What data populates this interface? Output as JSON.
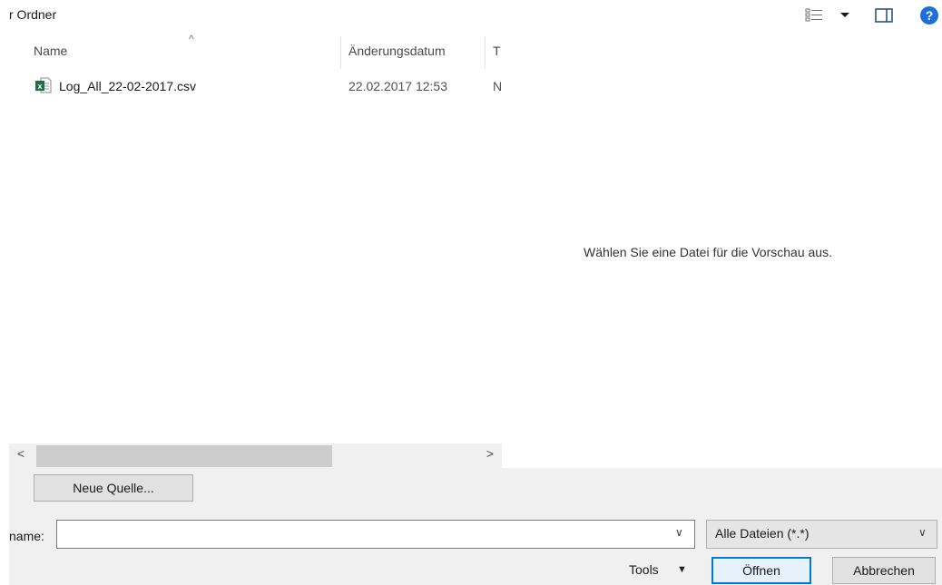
{
  "toolbar": {
    "new_folder_label": "r Ordner",
    "help_glyph": "?"
  },
  "file_list": {
    "columns": [
      "Name",
      "Änderungsdatum",
      "T"
    ],
    "sort_indicator": "^",
    "rows": [
      {
        "name": "Log_All_22-02-2017.csv",
        "modified": "22.02.2017 12:53",
        "type_partial": "N",
        "icon": "excel-csv-icon"
      }
    ]
  },
  "scrollbar": {
    "left_arrow": "<",
    "right_arrow": ">"
  },
  "preview": {
    "message": "Wählen Sie eine Datei für die Vorschau aus."
  },
  "neue_quelle_label": "Neue Quelle...",
  "filename": {
    "label": "name:",
    "value": "",
    "dropdown_glyph": "∨"
  },
  "filter": {
    "selected": "Alle Dateien (*.*)",
    "dropdown_glyph": "∨"
  },
  "actions": {
    "tools_label": "Tools",
    "tools_arrow": "▼",
    "open_label": "Öffnen",
    "cancel_label": "Abbrechen"
  },
  "colors": {
    "accent": "#0078d7",
    "help": "#1e6fd9",
    "excel_green": "#1d7044"
  }
}
